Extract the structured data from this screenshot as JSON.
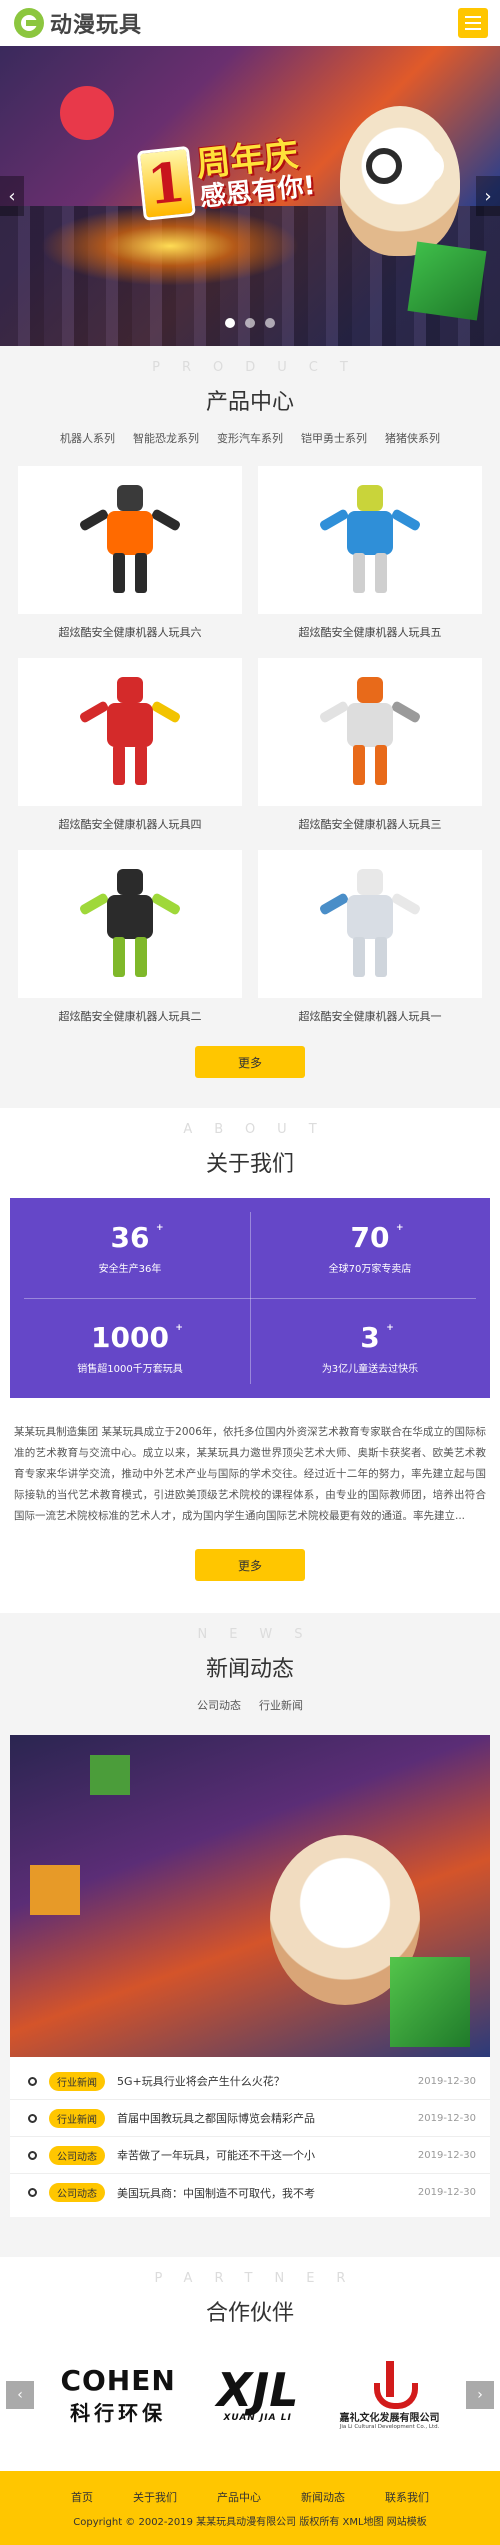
{
  "header": {
    "logo_text": "动漫玩具"
  },
  "banner": {
    "badge_number": "1",
    "badge_line1": "周年庆",
    "badge_line2": "感恩有你!",
    "prev": "‹",
    "next": "›"
  },
  "products": {
    "en_title": "PRODUCT",
    "title": "产品中心",
    "categories": [
      "机器人系列",
      "智能恐龙系列",
      "变形汽车系列",
      "铠甲勇士系列",
      "猪猪侠系列"
    ],
    "items": [
      {
        "name": "超炫酷安全健康机器人玩具六"
      },
      {
        "name": "超炫酷安全健康机器人玩具五"
      },
      {
        "name": "超炫酷安全健康机器人玩具四"
      },
      {
        "name": "超炫酷安全健康机器人玩具三"
      },
      {
        "name": "超炫酷安全健康机器人玩具二"
      },
      {
        "name": "超炫酷安全健康机器人玩具一"
      }
    ],
    "more_label": "更多"
  },
  "about": {
    "en_title": "ABOUT",
    "title": "关于我们",
    "stats": [
      {
        "num": "36",
        "sup": "+",
        "label": "安全生产36年"
      },
      {
        "num": "70",
        "sup": "+",
        "label": "全球70万家专卖店"
      },
      {
        "num": "1000",
        "sup": "+",
        "label": "销售超1000千万套玩具"
      },
      {
        "num": "3",
        "sup": "+",
        "label": "为3亿儿童送去过快乐"
      }
    ],
    "text": "某某玩具制造集团 某某玩具成立于2006年，依托多位国内外资深艺术教育专家联合在华成立的国际标准的艺术教育与交流中心。成立以来，某某玩具力邀世界顶尖艺术大师、奥斯卡获奖者、欧美艺术教育专家来华讲学交流，推动中外艺术产业与国际的学术交往。经过近十二年的努力，率先建立起与国际接轨的当代艺术教育模式，引进欧美顶级艺术院校的课程体系，由专业的国际教师团，培养出符合国际一流艺术院校标准的艺术人才，成为国内学生通向国际艺术院校最更有效的通道。率先建立...",
    "more_label": "更多"
  },
  "news": {
    "en_title": "NEWS",
    "title": "新闻动态",
    "tabs": [
      "公司动态",
      "行业新闻"
    ],
    "items": [
      {
        "tag": "行业新闻",
        "title": "5G+玩具行业将会产生什么火花？",
        "date": "2019-12-30"
      },
      {
        "tag": "行业新闻",
        "title": "首届中国教玩具之都国际博览会精彩产品",
        "date": "2019-12-30"
      },
      {
        "tag": "公司动态",
        "title": "幸苦做了一年玩具，可能还不干这一个小",
        "date": "2019-12-30"
      },
      {
        "tag": "公司动态",
        "title": "美国玩具商：中国制造不可取代，我不考",
        "date": "2019-12-30"
      }
    ]
  },
  "partner": {
    "en_title": "PARTNER",
    "title": "合作伙伴",
    "logos": {
      "cohen_a": "COHEN",
      "cohen_b": "科行环保",
      "xjl_a": "XJL",
      "xjl_b": "XUAN JIA LI",
      "jl_a": "嘉礼文化发展有限公司",
      "jl_b": "Jia Li Cultural Development Co., Ltd."
    },
    "prev": "‹",
    "next": "›"
  },
  "footer": {
    "nav": [
      "首页",
      "关于我们",
      "产品中心",
      "新闻动态",
      "联系我们"
    ],
    "copyright": "Copyright © 2002-2019 某某玩具动漫有限公司 版权所有 XML地图 网站模板"
  },
  "colors": {
    "accent": "#ffc600",
    "stats_bg": "#6547c8"
  }
}
